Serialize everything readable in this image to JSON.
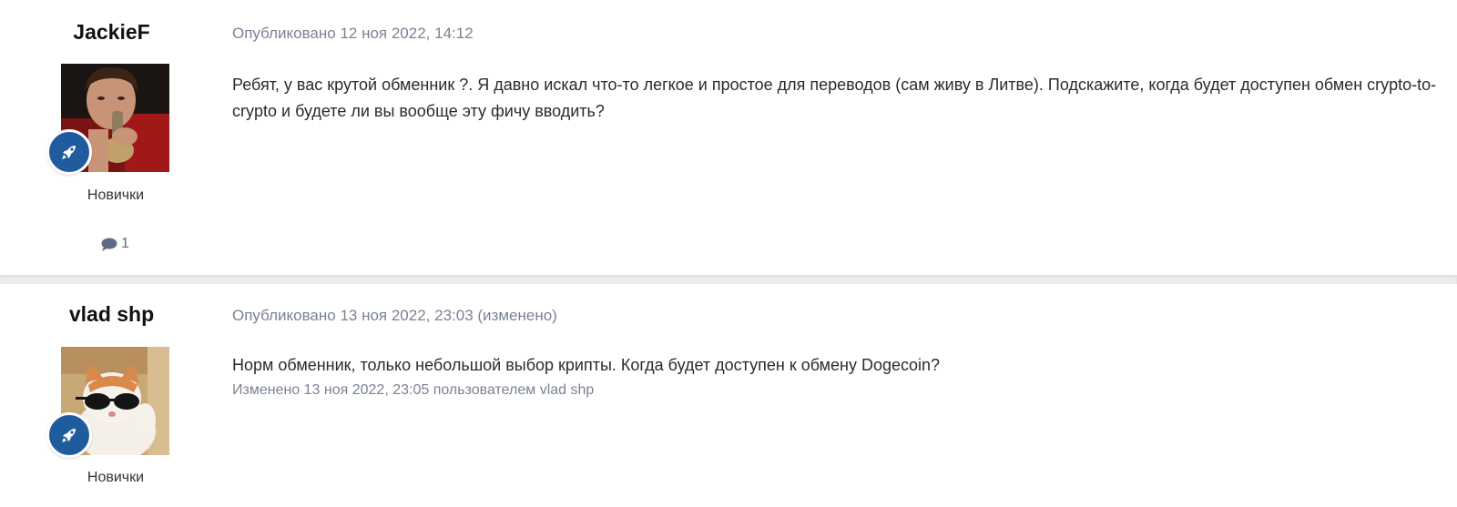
{
  "posts": [
    {
      "author": "JackieF",
      "avatar_icon": "user-avatar-photo",
      "rank_icon": "rocket-icon",
      "group": "Новички",
      "post_count": "1",
      "published": "Опубликовано 12 ноя 2022, 14:12",
      "content": "Ребят, у вас крутой обменник ?. Я давно искал что-то легкое и простое для переводов (сам живу в Литве). Подскажите, когда будет доступен обмен crypto-to-crypto и будете ли вы вообще эту фичу вводить?"
    },
    {
      "author": "vlad shp",
      "avatar_icon": "cat-sunglasses-avatar",
      "rank_icon": "rocket-icon",
      "group": "Новички",
      "published": "Опубликовано 13 ноя 2022, 23:03 (изменено)",
      "content": "Норм обменник, только небольшой выбор крипты. Когда будет доступен к обмену Dogecoin?",
      "edited_note": "Изменено 13 ноя 2022, 23:05 пользователем vlad shp"
    }
  ],
  "colors": {
    "badge": "#1f5c9e",
    "meta_text": "#7a8294",
    "separator": "#ececee"
  }
}
